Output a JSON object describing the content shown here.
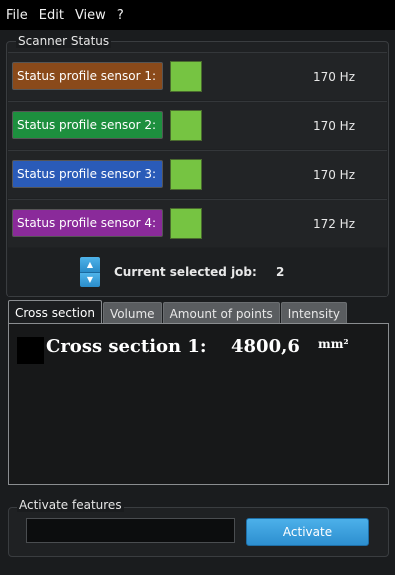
{
  "menu": {
    "items": [
      "File",
      "Edit",
      "View",
      "?"
    ]
  },
  "scanner_status": {
    "title": "Scanner Status",
    "indicator_color": "#76c442",
    "sensors": [
      {
        "label": "Status profile sensor 1:",
        "frequency": "170 Hz",
        "color": "#8a4a1a"
      },
      {
        "label": "Status profile sensor 2:",
        "frequency": "170 Hz",
        "color": "#1d8f3e"
      },
      {
        "label": "Status profile sensor 3:",
        "frequency": "170 Hz",
        "color": "#2a5bb8"
      },
      {
        "label": "Status profile sensor 4:",
        "frequency": "172 Hz",
        "color": "#8a2a9a"
      }
    ]
  },
  "job": {
    "label": "Current selected job:",
    "value": "2",
    "spin_up_icon": "triangle-up",
    "spin_down_icon": "triangle-down"
  },
  "tabs": [
    {
      "label": "Cross section",
      "active": true
    },
    {
      "label": "Volume",
      "active": false
    },
    {
      "label": "Amount of points",
      "active": false
    },
    {
      "label": "Intensity",
      "active": false
    }
  ],
  "cross_section": {
    "label": "Cross section 1:",
    "value": "4800,6",
    "unit": "mm²"
  },
  "activate_features": {
    "title": "Activate features",
    "input_value": "",
    "button_label": "Activate"
  }
}
